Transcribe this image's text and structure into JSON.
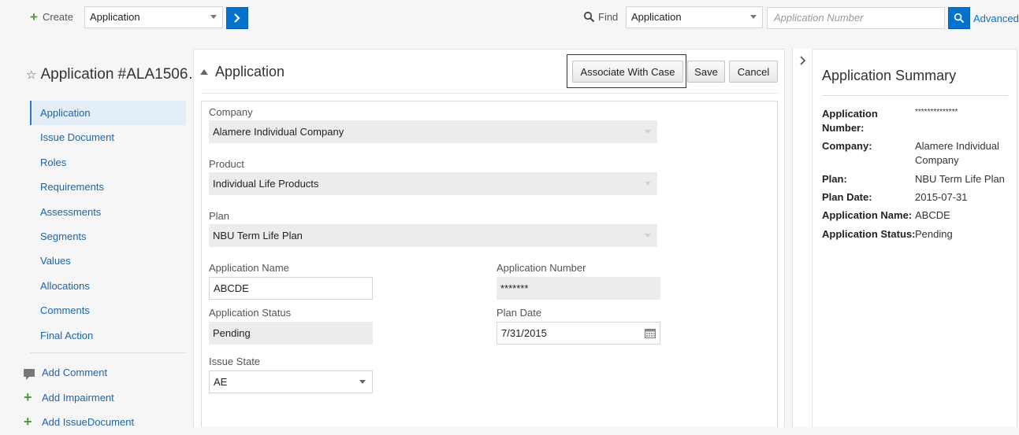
{
  "toolbar": {
    "create_label": "Create",
    "create_type": "Application",
    "find_label": "Find",
    "find_type": "Application",
    "search_placeholder": "Application Number",
    "advanced_label": "Advanced"
  },
  "page_title": "Application #ALA1506…",
  "nav": [
    {
      "label": "Application",
      "active": true
    },
    {
      "label": "Issue Document"
    },
    {
      "label": "Roles"
    },
    {
      "label": "Requirements"
    },
    {
      "label": "Assessments"
    },
    {
      "label": "Segments"
    },
    {
      "label": "Values"
    },
    {
      "label": "Allocations"
    },
    {
      "label": "Comments"
    },
    {
      "label": "Final Action"
    }
  ],
  "actions": [
    {
      "label": "Add Comment",
      "icon": "comment-icon"
    },
    {
      "label": "Add Impairment",
      "icon": "plus-icon"
    },
    {
      "label": "Add IssueDocument",
      "icon": "plus-icon"
    }
  ],
  "main": {
    "section_title": "Application",
    "buttons": {
      "associate": "Associate With Case",
      "save": "Save",
      "cancel": "Cancel"
    },
    "fields": {
      "company_label": "Company",
      "company_value": "Alamere Individual Company",
      "product_label": "Product",
      "product_value": "Individual Life Products",
      "plan_label": "Plan",
      "plan_value": "NBU Term Life Plan",
      "app_name_label": "Application Name",
      "app_name_value": "ABCDE",
      "app_number_label": "Application Number",
      "app_number_value": "*******",
      "app_status_label": "Application Status",
      "app_status_value": "Pending",
      "plan_date_label": "Plan Date",
      "plan_date_value": "7/31/2015",
      "issue_state_label": "Issue State",
      "issue_state_value": "AE"
    }
  },
  "summary": {
    "title": "Application Summary",
    "rows": [
      {
        "key": "Application Number:",
        "value": "**************"
      },
      {
        "key": "Company:",
        "value": "Alamere Individual Company"
      },
      {
        "key": "Plan:",
        "value": "NBU Term Life Plan"
      },
      {
        "key": "Plan Date:",
        "value": "2015-07-31"
      },
      {
        "key": "Application Name:",
        "value": "ABCDE"
      },
      {
        "key": "Application Status:",
        "value": "Pending"
      }
    ]
  },
  "colors": {
    "accent": "#0572ce",
    "link": "#1e64a6",
    "add_icon": "#4f9a3b"
  }
}
